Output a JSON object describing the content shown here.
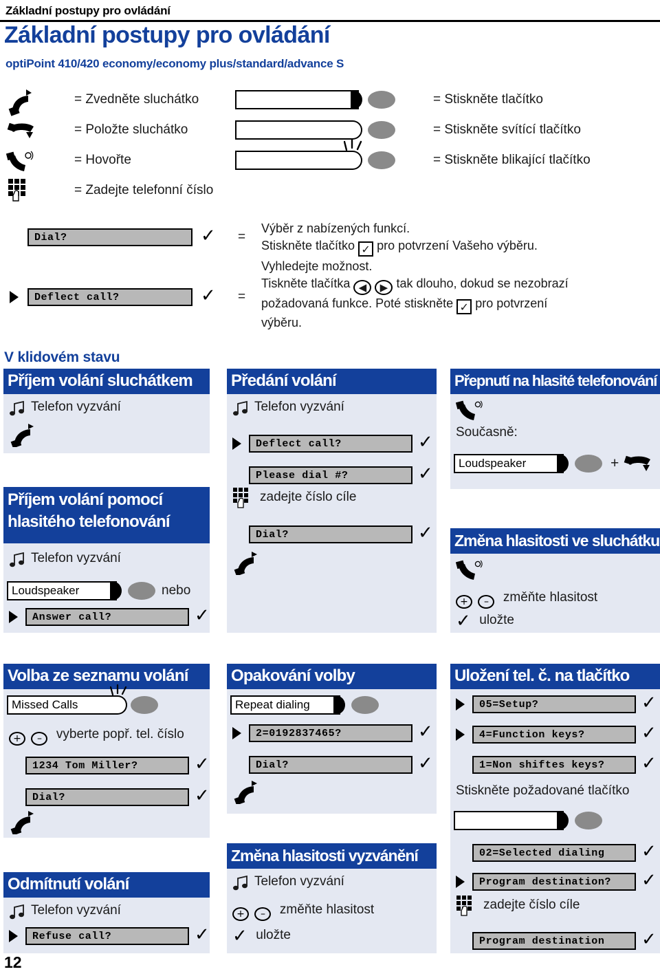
{
  "running_header": "Základní postupy pro ovládání",
  "title": "Základní postupy pro ovládání",
  "subtitle": "optiPoint 410/420 economy/economy plus/standard/advance S",
  "page_number": "12",
  "legend": {
    "left": [
      {
        "icon": "handset-lift-icon",
        "text": "= Zvedněte sluchátko"
      },
      {
        "icon": "handset-down-icon",
        "text": "= Položte sluchátko"
      },
      {
        "icon": "handset-talk-icon",
        "text": "= Hovořte"
      },
      {
        "icon": "keypad-icon",
        "text": "= Zadejte telefonní číslo"
      }
    ],
    "right": [
      {
        "icon": "key-solid-icon",
        "text": "= Stiskněte tlačítko"
      },
      {
        "icon": "key-lit-icon",
        "text": "= Stiskněte svítící tlačítko"
      },
      {
        "icon": "key-blinking-icon",
        "text": "= Stiskněte blikající tlačítko"
      }
    ]
  },
  "explanation": [
    {
      "field": "Dial?",
      "check": "✓",
      "equals": "=",
      "line1": "Výběr z nabízených funkcí.",
      "line2_a": "Stiskněte tlačítko",
      "line2_key": "✓",
      "line2_b": "pro potvrzení Vašeho výběru."
    },
    {
      "field": "Deflect call?",
      "check": "✓",
      "equals": "=",
      "line1": "Vyhledejte možnost.",
      "line2_a": "Tiskněte tlačítka",
      "line2_key_left": "◀",
      "line2_key_right": "▶",
      "line2_b": "tak dlouho, dokud se nezobrazí",
      "line3_a": "požadovaná funkce. Poté stiskněte",
      "line3_key": "✓",
      "line3_b": "pro potvrzení",
      "line4": "výběru."
    }
  ],
  "kicker": "V klidovém stavu",
  "panels": {
    "accept_handset": {
      "title": "Příjem volání sluchátkem",
      "ring_label": "Telefon vyzvání",
      "lift_icon": "handset-lift-icon"
    },
    "accept_speaker": {
      "title": "Příjem volání pomocí hlasitého telefonování",
      "ring_label": "Telefon vyzvání",
      "key_label": "Loudspeaker",
      "or_label": "nebo",
      "field": "Answer call?",
      "check": "✓"
    },
    "deflect": {
      "title": "Předání volání",
      "ring_label": "Telefon vyzvání",
      "field1": "Deflect call?",
      "check1": "✓",
      "field2": "Please dial #?",
      "check2": "✓",
      "keypad_label": "zadejte číslo cíle",
      "field3": "Dial?",
      "check3": "✓",
      "lift_icon": "handset-lift-icon"
    },
    "switch_speaker": {
      "title": "Přepnutí na hlasité telefonování",
      "talk_icon": "handset-talk-icon",
      "simultaneously": "Současně:",
      "key_label": "Loudspeaker",
      "plus": "+",
      "hangup_icon": "handset-down-icon"
    },
    "handset_volume": {
      "title": "Změna hlasitosti ve sluchátku",
      "talk_icon": "handset-talk-icon",
      "plus": "+",
      "minus": "–",
      "change_label": "změňte hlasitost",
      "check": "✓",
      "save_label": "uložte"
    },
    "call_list": {
      "title": "Volba ze seznamu volání",
      "key_label": "Missed Calls",
      "plus": "+",
      "minus": "–",
      "select_label": "vyberte popř. tel. číslo",
      "field1": "1234   Tom Miller?",
      "check1": "✓",
      "field2": "Dial?",
      "check2": "✓",
      "lift_icon": "handset-lift-icon"
    },
    "reject": {
      "title": "Odmítnutí volání",
      "ring_label": "Telefon vyzvání",
      "field": "Refuse call?",
      "check": "✓"
    },
    "redial": {
      "title": "Opakování volby",
      "key_label": "Repeat dialing",
      "field1": "2=0192837465?",
      "check1": "✓",
      "field2": "Dial?",
      "check2": "✓",
      "lift_icon": "handset-lift-icon"
    },
    "ring_volume": {
      "title": "Změna hlasitosti vyzvánění",
      "ring_label": "Telefon vyzvání",
      "plus": "+",
      "minus": "–",
      "change_label": "změňte hlasitost",
      "check": "✓",
      "save_label": "uložte"
    },
    "save_number": {
      "title": "Uložení tel. č. na tlačítko",
      "field1": "05=Setup?",
      "check1": "✓",
      "field2": "4=Function keys?",
      "check2": "✓",
      "field3": "1=Non shiftes keys?",
      "check3": "✓",
      "press_label": "Stiskněte požadované tlačítko",
      "key_label": "",
      "field4": "02=Selected dialing",
      "check4": "✓",
      "field5": "Program destination?",
      "check5": "✓",
      "keypad_label": "zadejte číslo cíle",
      "field6": "Program destination",
      "check6": "✓"
    }
  },
  "colors": {
    "brand_blue": "#13409B",
    "panel_bg": "#E4E8F2",
    "display_gray": "#B8B8B8",
    "lamp_gray": "#8A8A8A"
  }
}
